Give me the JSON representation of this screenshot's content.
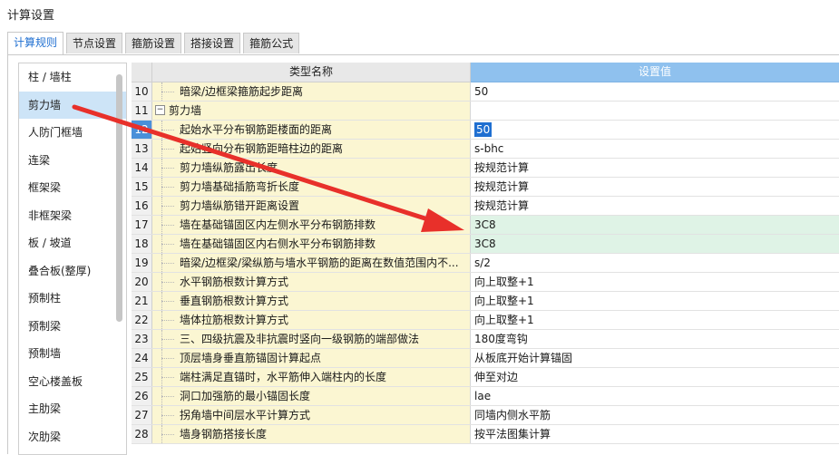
{
  "title": "计算设置",
  "tabs": [
    {
      "label": "计算规则",
      "active": true
    },
    {
      "label": "节点设置",
      "active": false
    },
    {
      "label": "箍筋设置",
      "active": false
    },
    {
      "label": "搭接设置",
      "active": false
    },
    {
      "label": "箍筋公式",
      "active": false
    }
  ],
  "sidebar": {
    "items": [
      {
        "label": "柱 / 墙柱"
      },
      {
        "label": "剪力墙"
      },
      {
        "label": "人防门框墙"
      },
      {
        "label": "连梁"
      },
      {
        "label": "框架梁"
      },
      {
        "label": "非框架梁"
      },
      {
        "label": "板 / 坡道"
      },
      {
        "label": "叠合板(整厚)"
      },
      {
        "label": "预制柱"
      },
      {
        "label": "预制梁"
      },
      {
        "label": "预制墙"
      },
      {
        "label": "空心楼盖板"
      },
      {
        "label": "主肋梁"
      },
      {
        "label": "次肋梁"
      }
    ],
    "selected_index": 1
  },
  "grid": {
    "col_name_header": "类型名称",
    "col_value_header": "设置值",
    "rows": [
      {
        "num": "10",
        "name": "暗梁/边框梁箍筋起步距离",
        "value": "50"
      },
      {
        "num": "11",
        "name": "剪力墙",
        "value": "",
        "group": true
      },
      {
        "num": "12",
        "name": "起始水平分布钢筋距楼面的距离",
        "value": "50",
        "editing": true
      },
      {
        "num": "13",
        "name": "起始竖向分布钢筋距暗柱边的距离",
        "value": "s-bhc"
      },
      {
        "num": "14",
        "name": "剪力墙纵筋露出长度",
        "value": "按规范计算"
      },
      {
        "num": "15",
        "name": "剪力墙基础插筋弯折长度",
        "value": "按规范计算"
      },
      {
        "num": "16",
        "name": "剪力墙纵筋错开距离设置",
        "value": "按规范计算"
      },
      {
        "num": "17",
        "name": "墙在基础锚固区内左侧水平分布钢筋排数",
        "value": "3C8",
        "highlight": true
      },
      {
        "num": "18",
        "name": "墙在基础锚固区内右侧水平分布钢筋排数",
        "value": "3C8",
        "highlight": true
      },
      {
        "num": "19",
        "name": "暗梁/边框梁/梁纵筋与墙水平钢筋的距离在数值范围内不...",
        "value": "s/2"
      },
      {
        "num": "20",
        "name": "水平钢筋根数计算方式",
        "value": "向上取整+1"
      },
      {
        "num": "21",
        "name": "垂直钢筋根数计算方式",
        "value": "向上取整+1"
      },
      {
        "num": "22",
        "name": "墙体拉筋根数计算方式",
        "value": "向上取整+1"
      },
      {
        "num": "23",
        "name": "三、四级抗震及非抗震时竖向一级钢筋的端部做法",
        "value": "180度弯钩"
      },
      {
        "num": "24",
        "name": "顶层墙身垂直筋锚固计算起点",
        "value": "从板底开始计算锚固"
      },
      {
        "num": "25",
        "name": "端柱满足直锚时，水平筋伸入端柱内的长度",
        "value": "伸至对边"
      },
      {
        "num": "26",
        "name": "洞口加强筋的最小锚固长度",
        "value": "lae"
      },
      {
        "num": "27",
        "name": "拐角墙中间层水平计算方式",
        "value": "同墙内侧水平筋"
      },
      {
        "num": "28",
        "name": "墙身钢筋搭接长度",
        "value": "按平法图集计算"
      }
    ]
  },
  "colors": {
    "accent": "#1f6fd1",
    "arrow": "#e8302a",
    "name_bg": "#fbf6d2",
    "highlight_bg": "#dff3e6",
    "selected_sidebar": "#cde4f7"
  }
}
